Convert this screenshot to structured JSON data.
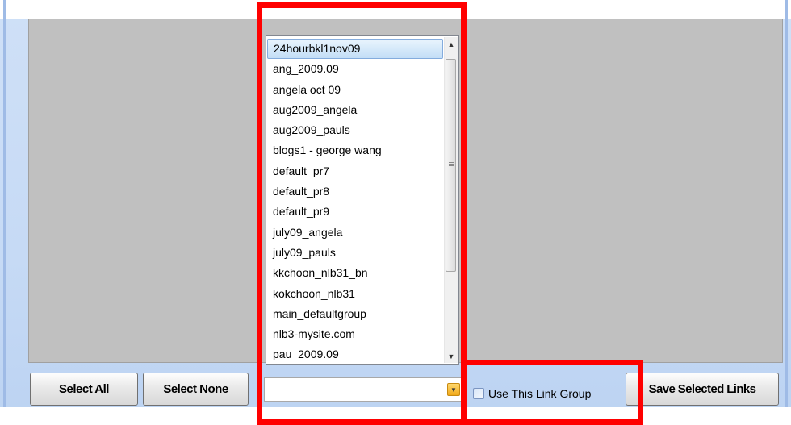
{
  "list": {
    "items": [
      "24hourbkl1nov09",
      "ang_2009.09",
      "angela oct 09",
      "aug2009_angela",
      "aug2009_pauls",
      "blogs1 - george wang",
      "default_pr7",
      "default_pr8",
      "default_pr9",
      "july09_angela",
      "july09_pauls",
      "kkchoon_nlb31_bn",
      "kokchoon_nlb31",
      "main_defaultgroup",
      "nlb3-mysite.com",
      "pau_2009.09"
    ],
    "selected": "24hourbkl1nov09"
  },
  "combo": {
    "value": ""
  },
  "buttons": {
    "select_all": "Select All",
    "select_none": "Select None",
    "save_selected": "Save Selected Links"
  },
  "checkbox": {
    "label": "Use This Link Group",
    "checked": false
  },
  "colors": {
    "highlight": "#ff0000",
    "panel": "#c0c0c0",
    "frame": "#c6daf5"
  },
  "icons": {
    "scroll_up": "triangle-up-icon",
    "scroll_down": "triangle-down-icon",
    "dropdown": "chevron-down-icon"
  }
}
